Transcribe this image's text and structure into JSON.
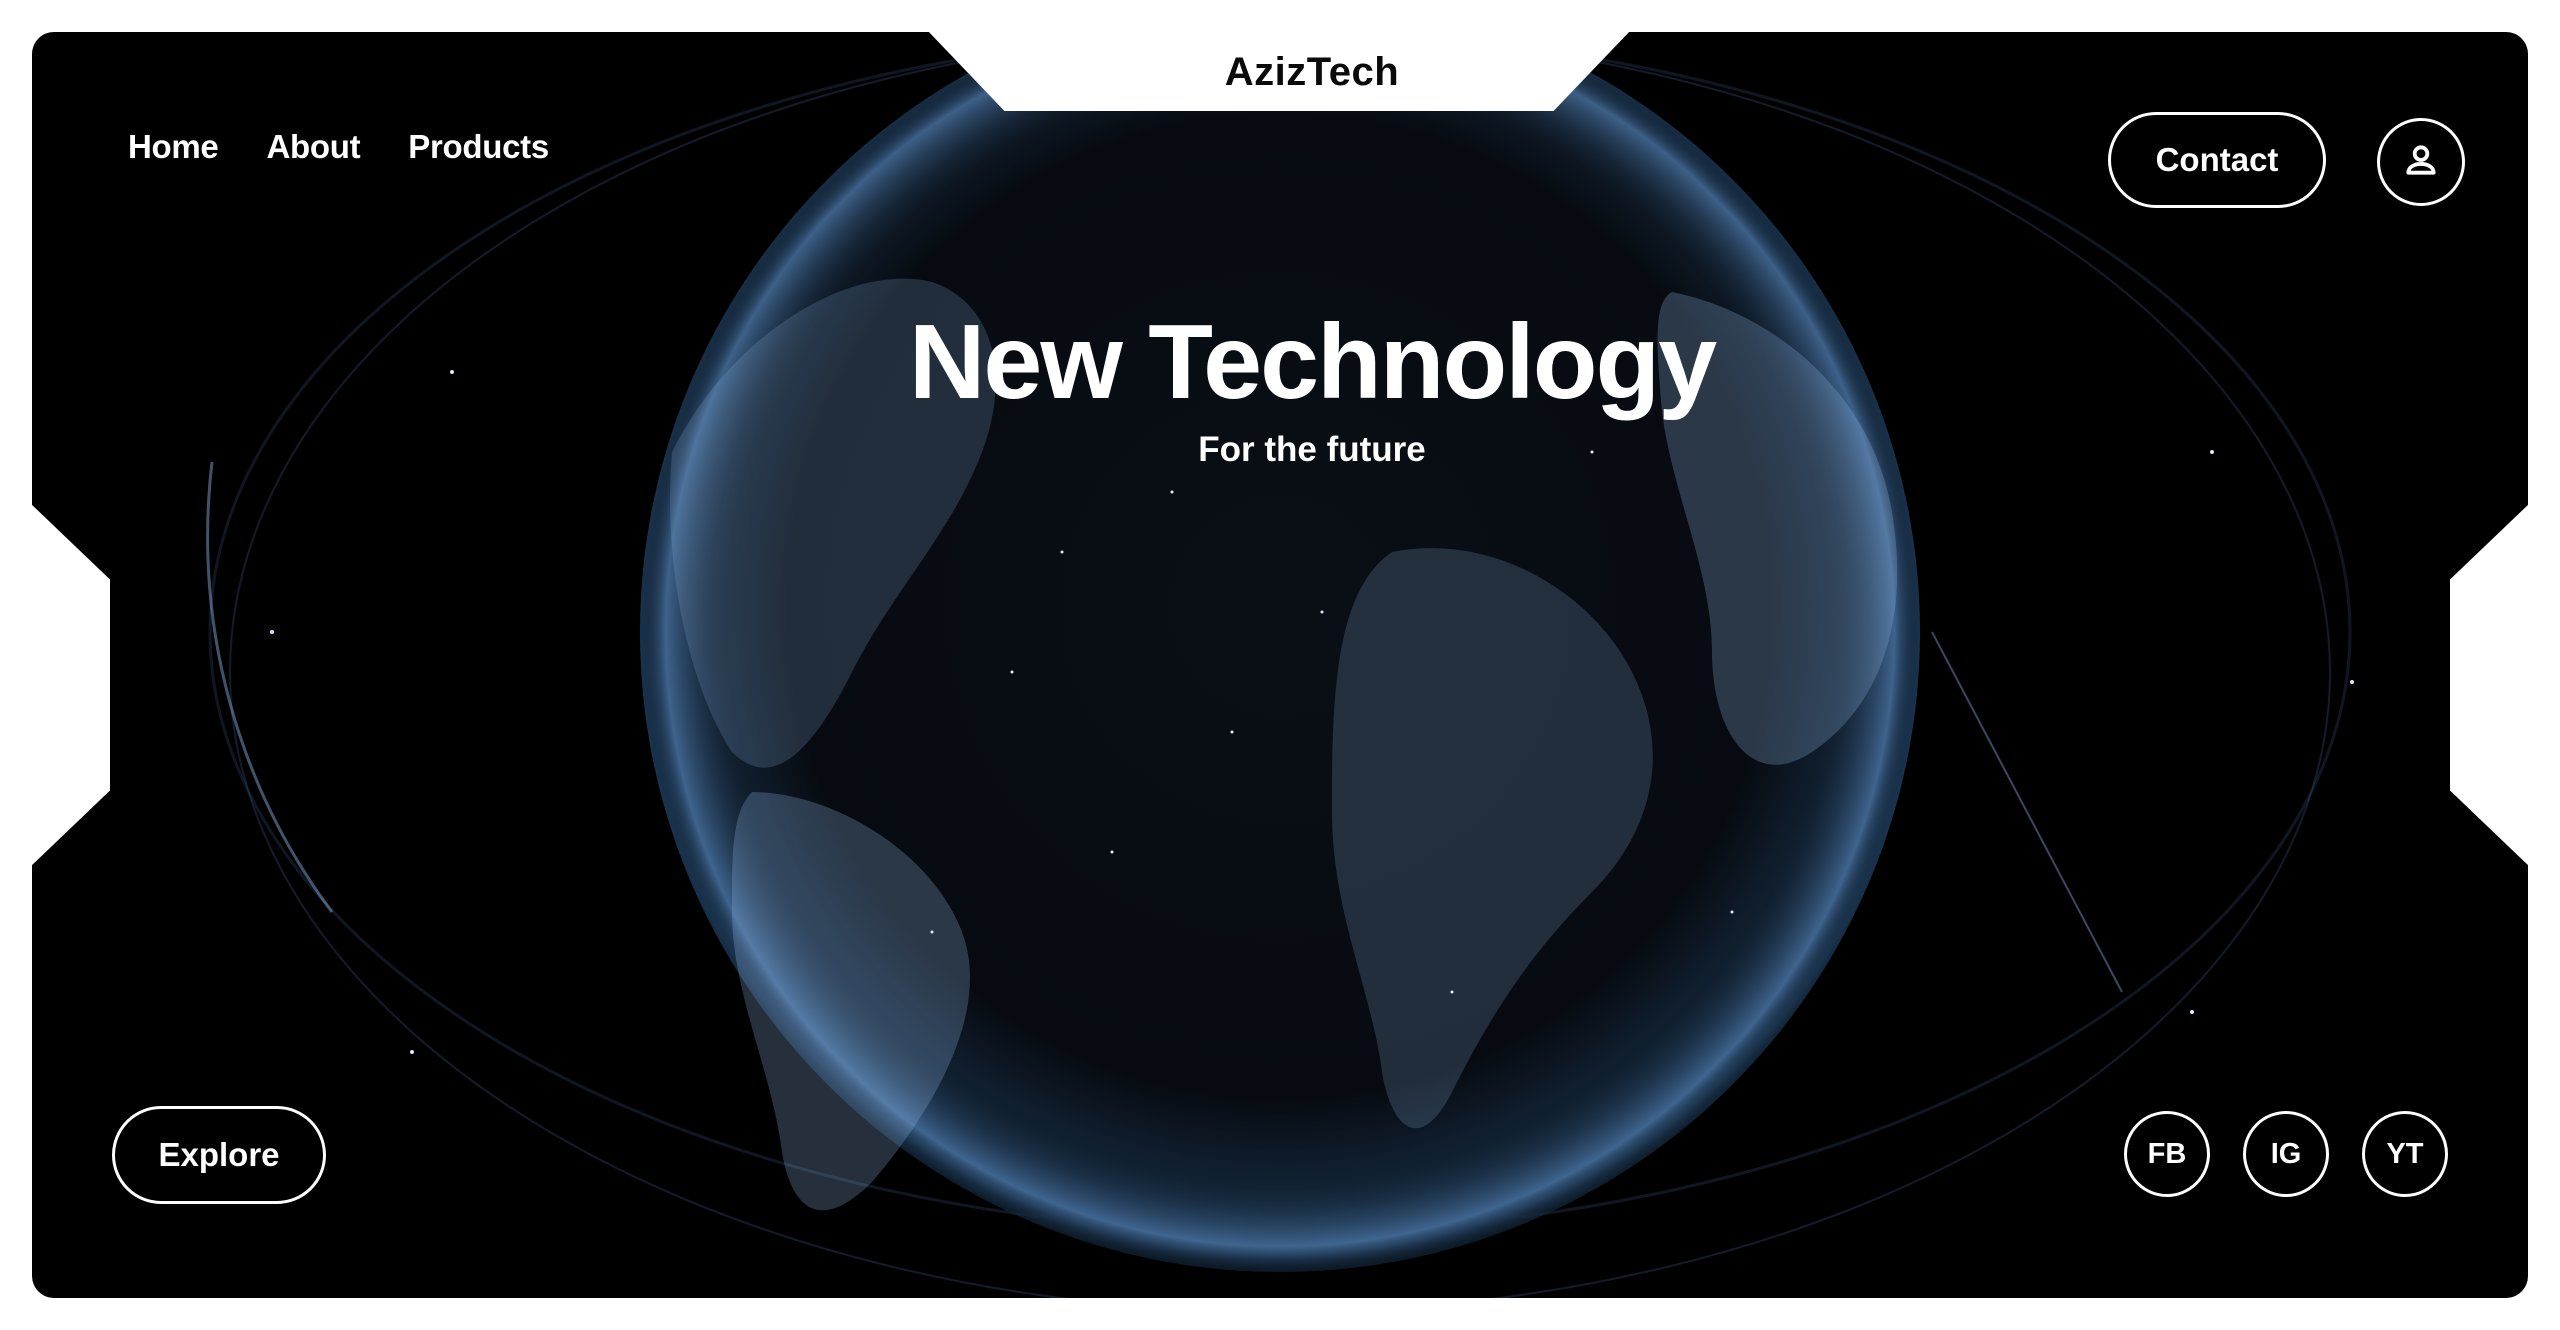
{
  "brand": {
    "name": "AzizTech"
  },
  "nav": {
    "items": [
      {
        "label": "Home"
      },
      {
        "label": "About"
      },
      {
        "label": "Products"
      }
    ]
  },
  "header_actions": {
    "contact_label": "Contact",
    "user_icon": "user-icon"
  },
  "hero": {
    "title": "New Technology",
    "subtitle": "For the future",
    "background_image": "digital-earth-globe"
  },
  "cta": {
    "explore_label": "Explore"
  },
  "social": {
    "items": [
      {
        "label": "FB"
      },
      {
        "label": "IG"
      },
      {
        "label": "YT"
      }
    ]
  },
  "colors": {
    "background": "#000000",
    "foreground": "#ffffff",
    "page": "#ffffff",
    "globe_glow": "#8fb7e8"
  }
}
